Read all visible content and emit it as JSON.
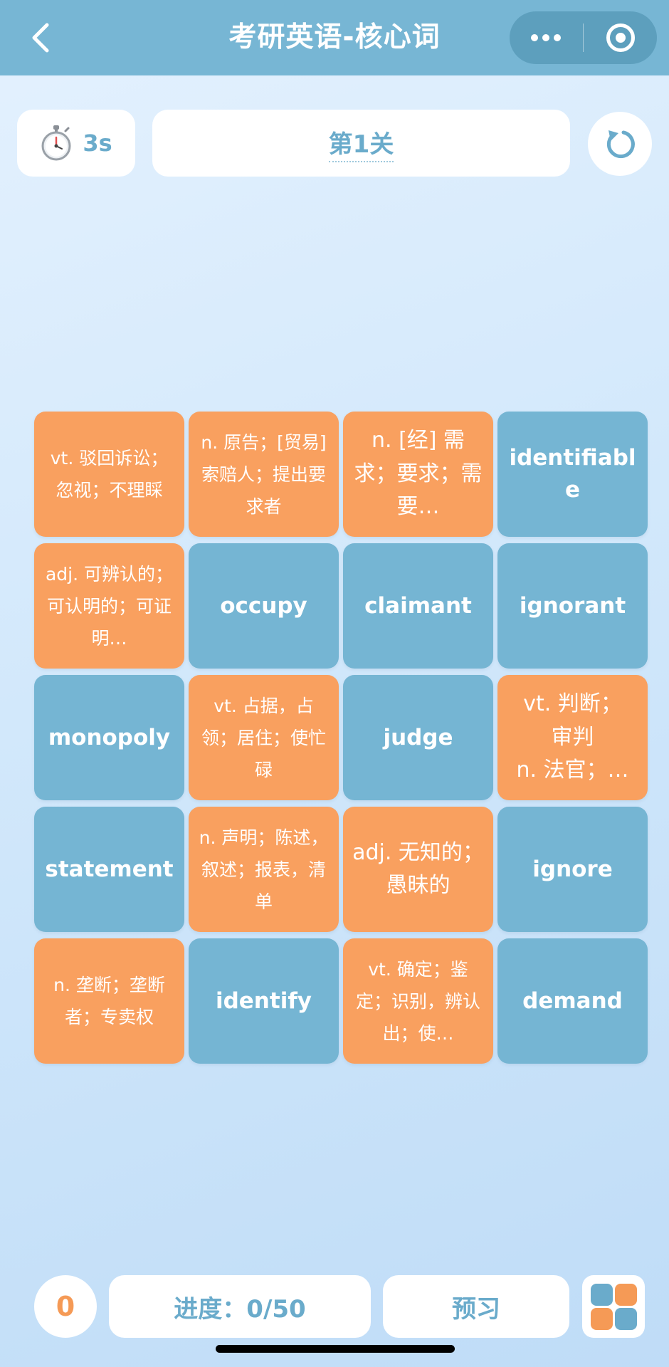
{
  "header": {
    "title": "考研英语-核心词",
    "back_icon": "chevron-left-icon",
    "menu_icon": "more-dots-icon",
    "close_icon": "target-icon"
  },
  "toolbar": {
    "timer_icon": "stopwatch-icon",
    "timer_value": "3s",
    "level_label": "第1关",
    "refresh_icon": "refresh-icon"
  },
  "colors": {
    "header_bg": "#77b6d4",
    "word_tile": "#75b5d3",
    "definition_tile": "#f9a05f",
    "accent_text": "#6aabcb",
    "score_text": "#f59a56"
  },
  "tiles": [
    {
      "type": "def",
      "text": "vt. 驳回诉讼；忽视；不理睬"
    },
    {
      "type": "def",
      "text": "n. 原告；[贸易] 索赔人；提出要求者"
    },
    {
      "type": "def",
      "text": "n. [经] 需求；要求；需要…",
      "big": true
    },
    {
      "type": "word",
      "text": "identifiable"
    },
    {
      "type": "def",
      "text": "adj. 可辨认的；可认明的；可证明…"
    },
    {
      "type": "word",
      "text": "occupy"
    },
    {
      "type": "word",
      "text": "claimant"
    },
    {
      "type": "word",
      "text": "ignorant"
    },
    {
      "type": "word",
      "text": "monopoly"
    },
    {
      "type": "def",
      "text": "vt. 占据，占领；居住；使忙碌"
    },
    {
      "type": "word",
      "text": "judge"
    },
    {
      "type": "def",
      "text": "vt. 判断；\n审判\nn. 法官；…",
      "big": true
    },
    {
      "type": "word",
      "text": "statement"
    },
    {
      "type": "def",
      "text": "n. 声明；陈述，叙述；报表，清单"
    },
    {
      "type": "def",
      "text": "adj. 无知的；愚昧的",
      "big": true
    },
    {
      "type": "word",
      "text": "ignore"
    },
    {
      "type": "def",
      "text": "n. 垄断；垄断者；专卖权"
    },
    {
      "type": "word",
      "text": "identify"
    },
    {
      "type": "def",
      "text": "vt. 确定；鉴定；识别，辨认出；使…"
    },
    {
      "type": "word",
      "text": "demand"
    }
  ],
  "footer": {
    "score": "0",
    "progress_label": "进度：0/50",
    "preview_label": "预习",
    "layout_icon": "grid-layout-icon",
    "layout_colors": [
      "#6aabcb",
      "#f59a56",
      "#f59a56",
      "#6aabcb"
    ]
  }
}
